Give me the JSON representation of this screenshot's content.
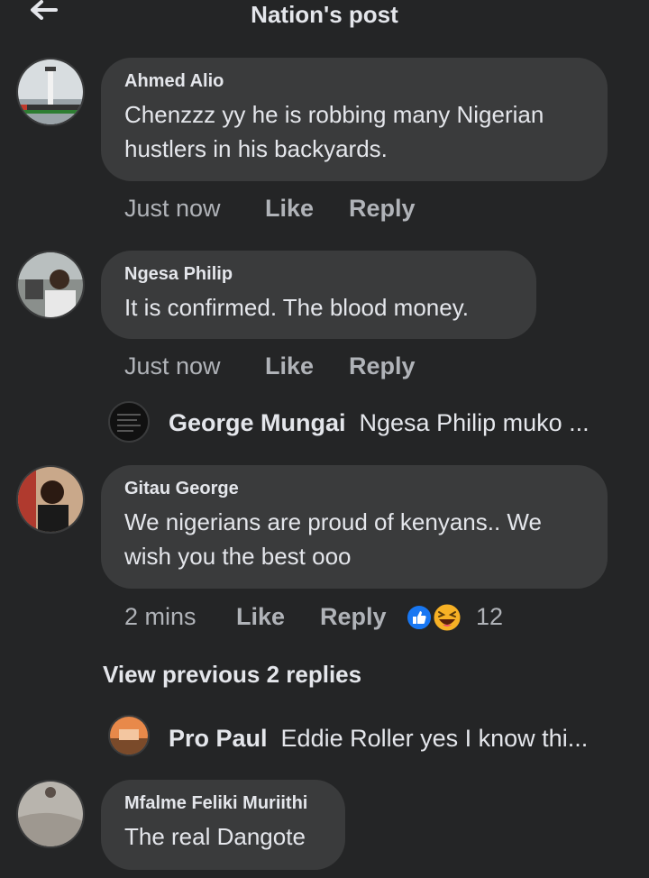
{
  "header": {
    "title": "Nation's post"
  },
  "comments": [
    {
      "author": "Ahmed Alio",
      "text": "Chenzzz yy he is robbing many Nigerian hustlers in his backyards.",
      "time": "Just now",
      "like": "Like",
      "reply": "Reply"
    },
    {
      "author": "Ngesa Philip",
      "text": "It is confirmed. The blood money.",
      "time": "Just now",
      "like": "Like",
      "reply": "Reply"
    },
    {
      "author": "Gitau George",
      "text": "We nigerians are proud of kenyans.. We wish you the best ooo",
      "time": "2 mins",
      "like": "Like",
      "reply": "Reply",
      "reaction_count": "12"
    },
    {
      "author": "Mfalme Feliki Muriithi",
      "text": "The real Dangote"
    }
  ],
  "replies": [
    {
      "name": "George Mungai",
      "preview": "Ngesa Philip muko ..."
    },
    {
      "name": "Pro Paul",
      "preview": "Eddie Roller yes I know thi..."
    }
  ],
  "view_previous": "View previous 2 replies",
  "icons": [
    "back-arrow-icon",
    "like-reaction-icon",
    "haha-reaction-icon"
  ],
  "colors": {
    "background": "#242526",
    "bubble": "#3a3b3c",
    "like_blue": "#1877f2",
    "haha_yellow": "#f7b125"
  }
}
